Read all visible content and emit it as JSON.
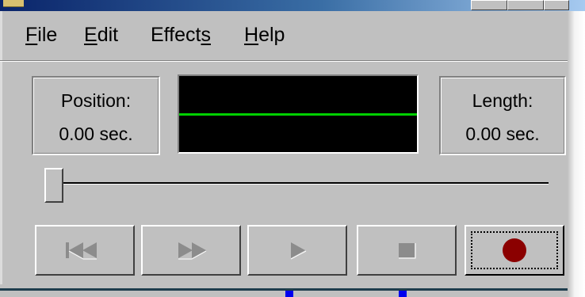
{
  "window": {
    "title_bar": {
      "gradient_start": "#0a246a",
      "gradient_end": "#a6caf0"
    }
  },
  "menu": {
    "items": [
      {
        "label_pre": "",
        "label_accel": "F",
        "label_post": "ile"
      },
      {
        "label_pre": "",
        "label_accel": "E",
        "label_post": "dit"
      },
      {
        "label_pre": "Effect",
        "label_accel": "s",
        "label_post": ""
      },
      {
        "label_pre": "",
        "label_accel": "H",
        "label_post": "elp"
      }
    ]
  },
  "position_panel": {
    "label": "Position:",
    "value": "0.00 sec."
  },
  "length_panel": {
    "label": "Length:",
    "value": "0.00 sec."
  },
  "waveform": {
    "background": "#000000",
    "line_color": "#00d000"
  },
  "seek_slider": {
    "position_fraction": 0.0
  },
  "transport": {
    "buttons": [
      {
        "icon": "seek-to-start-icon",
        "enabled": false
      },
      {
        "icon": "seek-to-end-icon",
        "enabled": false
      },
      {
        "icon": "play-icon",
        "enabled": false
      },
      {
        "icon": "stop-icon",
        "enabled": false
      },
      {
        "icon": "record-icon",
        "enabled": true,
        "focused": true,
        "color": "#8b0000"
      }
    ]
  }
}
